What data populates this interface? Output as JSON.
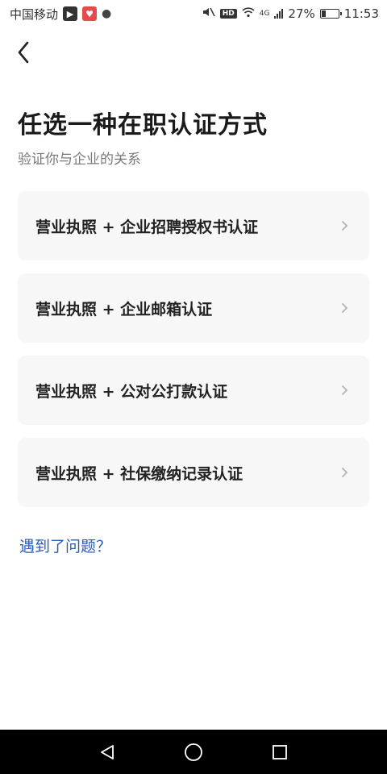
{
  "status_bar": {
    "carrier": "中国移动",
    "network": "4G",
    "battery": "27%",
    "battery_level": 0.27,
    "time": "11:53"
  },
  "page": {
    "title": "任选一种在职认证方式",
    "subtitle": "验证你与企业的关系"
  },
  "options": [
    {
      "label": "营业执照 + 企业招聘授权书认证"
    },
    {
      "label": "营业执照 + 企业邮箱认证"
    },
    {
      "label": "营业执照 + 公对公打款认证"
    },
    {
      "label": "营业执照 + 社保缴纳记录认证"
    }
  ],
  "help_link": "遇到了问题？",
  "icons": {
    "back": "chevron-left-icon",
    "option_arrow": "chevron-right-icon",
    "nav_back": "triangle-back-icon",
    "nav_home": "circle-home-icon",
    "nav_recent": "square-recent-icon"
  },
  "colors": {
    "link": "#2a5db8",
    "card_bg": "#f7f7f7",
    "nav_bar": "#000000"
  }
}
